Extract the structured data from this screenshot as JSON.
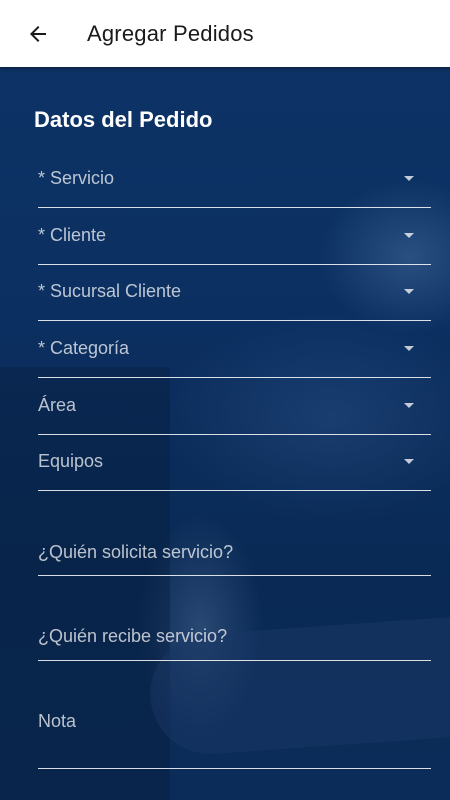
{
  "appbar": {
    "title": "Agregar Pedidos",
    "back_icon": "arrow-left-icon"
  },
  "form": {
    "section_title": "Datos del Pedido",
    "dropdowns": [
      {
        "label": "* Servicio"
      },
      {
        "label": "* Cliente"
      },
      {
        "label": "* Sucursal Cliente"
      },
      {
        "label": "* Categoría"
      },
      {
        "label": "Área"
      },
      {
        "label": "Equipos"
      }
    ],
    "inputs": [
      {
        "placeholder": "¿Quién solicita servicio?"
      },
      {
        "placeholder": "¿Quién recibe servicio?"
      },
      {
        "placeholder": "Nota"
      }
    ]
  },
  "colors": {
    "appbar_bg": "#ffffff",
    "background": "#0b2a55",
    "text_light": "#ffffff"
  }
}
